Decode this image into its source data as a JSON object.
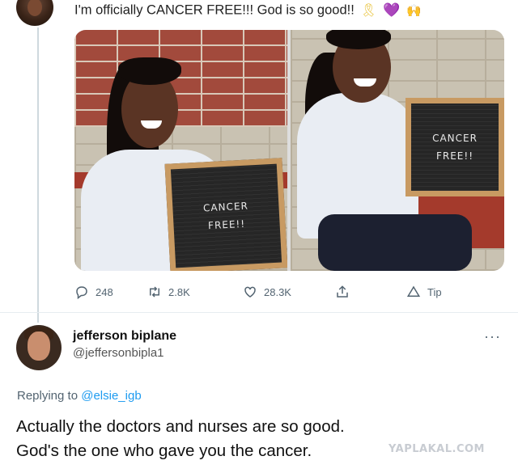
{
  "tweet": {
    "text": "I'm officially CANCER FREE!!! God is so good!!",
    "emojis": [
      {
        "name": "ribbon-icon",
        "glyph": "🎗"
      },
      {
        "name": "purple-heart-icon",
        "glyph": "💜"
      },
      {
        "name": "raised-hands-icon",
        "glyph": "🙌"
      }
    ],
    "board_left": [
      "CANCER",
      "FREE!!"
    ],
    "board_right": [
      "CANCER",
      "FREE!!"
    ],
    "stats": {
      "replies": "248",
      "retweets": "2.8K",
      "likes": "28.3K",
      "tip": "Tip"
    }
  },
  "reply_tweet": {
    "name": "jefferson biplane",
    "handle": "@jeffersonbipla1",
    "more": "···",
    "replying_prefix": "Replying to",
    "replying_to": "@elsie_igb",
    "lines": [
      "Actually the doctors and nurses are so good.",
      "God's the one who gave you the cancer."
    ]
  },
  "watermark": "YAPLAKAL.COM",
  "colors": {
    "link": "#1d9bf0",
    "muted": "#536471",
    "brick": "#a24a3c",
    "board_frame": "#c89a62"
  }
}
